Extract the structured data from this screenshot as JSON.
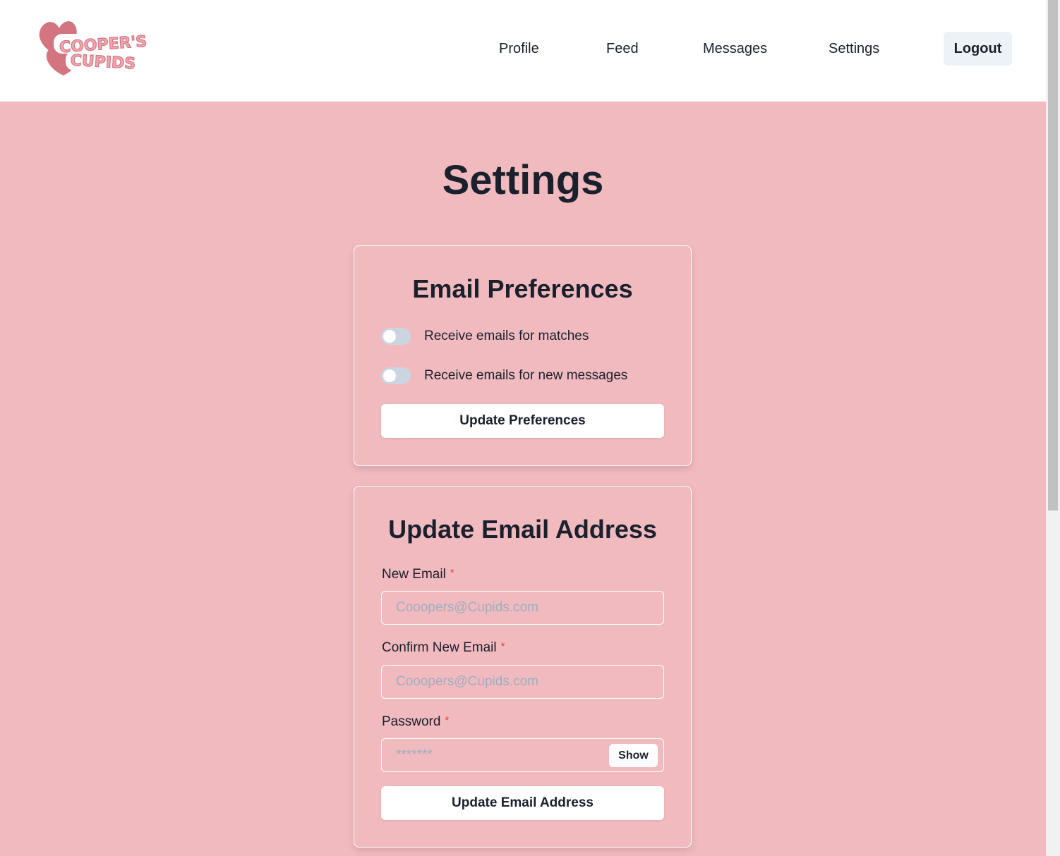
{
  "brand": {
    "logo_line1": "COOPER'S",
    "logo_line2": "CUPIDS"
  },
  "nav": {
    "items": [
      {
        "label": "Profile"
      },
      {
        "label": "Feed"
      },
      {
        "label": "Messages"
      },
      {
        "label": "Settings"
      }
    ],
    "logout_label": "Logout"
  },
  "page": {
    "title": "Settings"
  },
  "email_preferences": {
    "title": "Email Preferences",
    "toggles": [
      {
        "label": "Receive emails for matches",
        "checked": false
      },
      {
        "label": "Receive emails for new messages",
        "checked": false
      }
    ],
    "submit_label": "Update Preferences"
  },
  "update_email": {
    "title": "Update Email Address",
    "new_email": {
      "label": "New Email",
      "required_mark": "*",
      "placeholder": "Cooopers@Cupids.com",
      "value": ""
    },
    "confirm_email": {
      "label": "Confirm New Email",
      "required_mark": "*",
      "placeholder": "Cooopers@Cupids.com",
      "value": ""
    },
    "password": {
      "label": "Password",
      "required_mark": "*",
      "placeholder": "*******",
      "value": "",
      "show_label": "Show"
    },
    "submit_label": "Update Email Address"
  },
  "colors": {
    "background": "#f1babf",
    "logo_pink": "#d27580",
    "text": "#1a202c",
    "required": "#e53e3e"
  }
}
